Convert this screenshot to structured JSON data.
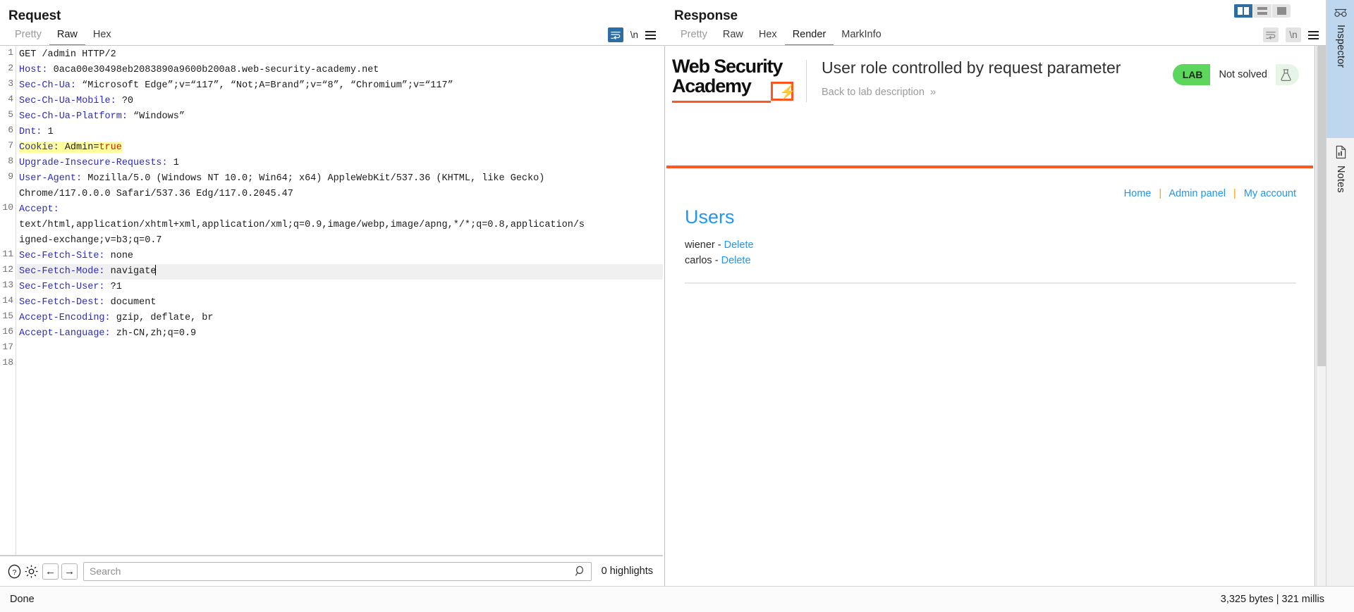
{
  "request": {
    "title": "Request",
    "tabs": [
      {
        "label": "Pretty",
        "active": false,
        "dim": true
      },
      {
        "label": "Raw",
        "active": true,
        "dim": false
      },
      {
        "label": "Hex",
        "active": false,
        "dim": false
      }
    ],
    "toolbar": {
      "wrap_icon": "word-wrap-icon",
      "newline_label": "\\n",
      "menu_icon": "hamburger-menu-icon"
    },
    "lines": [
      {
        "n": "1",
        "name": "",
        "value": "GET /admin HTTP/2"
      },
      {
        "n": "2",
        "name": "Host:",
        "value": " 0aca00e30498eb2083890a9600b200a8.web-security-academy.net"
      },
      {
        "n": "3",
        "name": "Sec-Ch-Ua:",
        "value": " “Microsoft Edge”;v=“117”, “Not;A=Brand”;v=“8”, “Chromium”;v=“117”"
      },
      {
        "n": "4",
        "name": "Sec-Ch-Ua-Mobile:",
        "value": " ?0"
      },
      {
        "n": "5",
        "name": "Sec-Ch-Ua-Platform:",
        "value": " “Windows”"
      },
      {
        "n": "6",
        "name": "Dnt:",
        "value": " 1"
      },
      {
        "n": "7",
        "name": "Cookie:",
        "value": " Admin=",
        "highlight": true,
        "red_tail": "true"
      },
      {
        "n": "8",
        "name": "Upgrade-Insecure-Requests:",
        "value": " 1"
      },
      {
        "n": "9",
        "name": "User-Agent:",
        "value": " Mozilla/5.0 (Windows NT 10.0; Win64; x64) AppleWebKit/537.36 (KHTML, like Gecko)"
      },
      {
        "n": "",
        "name": "",
        "value": "Chrome/117.0.0.0 Safari/537.36 Edg/117.0.2045.47",
        "cont": true
      },
      {
        "n": "10",
        "name": "Accept:",
        "value": ""
      },
      {
        "n": "",
        "name": "",
        "value": "text/html,application/xhtml+xml,application/xml;q=0.9,image/webp,image/apng,*/*;q=0.8,application/s",
        "cont": true
      },
      {
        "n": "",
        "name": "",
        "value": "igned-exchange;v=b3;q=0.7",
        "cont": true
      },
      {
        "n": "11",
        "name": "Sec-Fetch-Site:",
        "value": " none"
      },
      {
        "n": "12",
        "name": "Sec-Fetch-Mode:",
        "value": " navigate",
        "current": true,
        "caret": true
      },
      {
        "n": "13",
        "name": "Sec-Fetch-User:",
        "value": " ?1"
      },
      {
        "n": "14",
        "name": "Sec-Fetch-Dest:",
        "value": " document"
      },
      {
        "n": "15",
        "name": "Accept-Encoding:",
        "value": " gzip, deflate, br"
      },
      {
        "n": "16",
        "name": "Accept-Language:",
        "value": " zh-CN,zh;q=0.9"
      },
      {
        "n": "17",
        "name": "",
        "value": ""
      },
      {
        "n": "18",
        "name": "",
        "value": ""
      }
    ],
    "search": {
      "placeholder": "Search",
      "value": "",
      "highlights_label": "0 highlights",
      "help_icon": "help-circle-icon",
      "settings_icon": "gear-icon",
      "prev_icon": "arrow-left-icon",
      "next_icon": "arrow-right-icon",
      "magnifier_icon": "search-icon"
    }
  },
  "response": {
    "title": "Response",
    "tabs": [
      {
        "label": "Pretty",
        "active": false,
        "dim": false
      },
      {
        "label": "Raw",
        "active": false,
        "dim": false
      },
      {
        "label": "Hex",
        "active": false,
        "dim": false
      },
      {
        "label": "Render",
        "active": true,
        "dim": false
      },
      {
        "label": "MarkInfo",
        "active": false,
        "dim": false
      }
    ],
    "toolbar": {
      "wrap_icon": "word-wrap-icon",
      "newline_label": "\\n",
      "menu_icon": "hamburger-menu-icon"
    }
  },
  "layout_toggle": {
    "options": [
      "side-by-side-layout",
      "stacked-layout",
      "single-layout"
    ],
    "active_index": 0
  },
  "render": {
    "logo": {
      "line1": "Web Security",
      "line2": "Academy",
      "bolt": "⚡"
    },
    "lab_title": "User role controlled by request parameter",
    "back_link": "Back to lab description",
    "back_chevron": "»",
    "status": {
      "tag": "LAB",
      "state": "Not solved",
      "flask_icon": "flask-icon"
    },
    "nav": [
      {
        "label": "Home"
      },
      {
        "label": "Admin panel"
      },
      {
        "label": "My account"
      }
    ],
    "nav_separator": "|",
    "heading": "Users",
    "users": [
      {
        "name": "wiener",
        "dash": "-",
        "action": "Delete"
      },
      {
        "name": "carlos",
        "dash": "-",
        "action": "Delete"
      }
    ]
  },
  "rail": {
    "tabs": [
      {
        "label": "Inspector",
        "icon": "spectacles-icon",
        "active": true
      },
      {
        "label": "Notes",
        "icon": "document-icon",
        "active": false
      }
    ]
  },
  "statusbar": {
    "left": "Done",
    "right": "3,325 bytes | 321 millis"
  },
  "colors": {
    "accent_orange": "#ff5722",
    "tab_underline": "#e8600a",
    "link_blue": "#2196f3",
    "header_blue": "#2b2bc8",
    "highlight_yellow": "#ffff9e",
    "lab_green": "#5cd65c",
    "active_blue": "#2e6da4"
  }
}
